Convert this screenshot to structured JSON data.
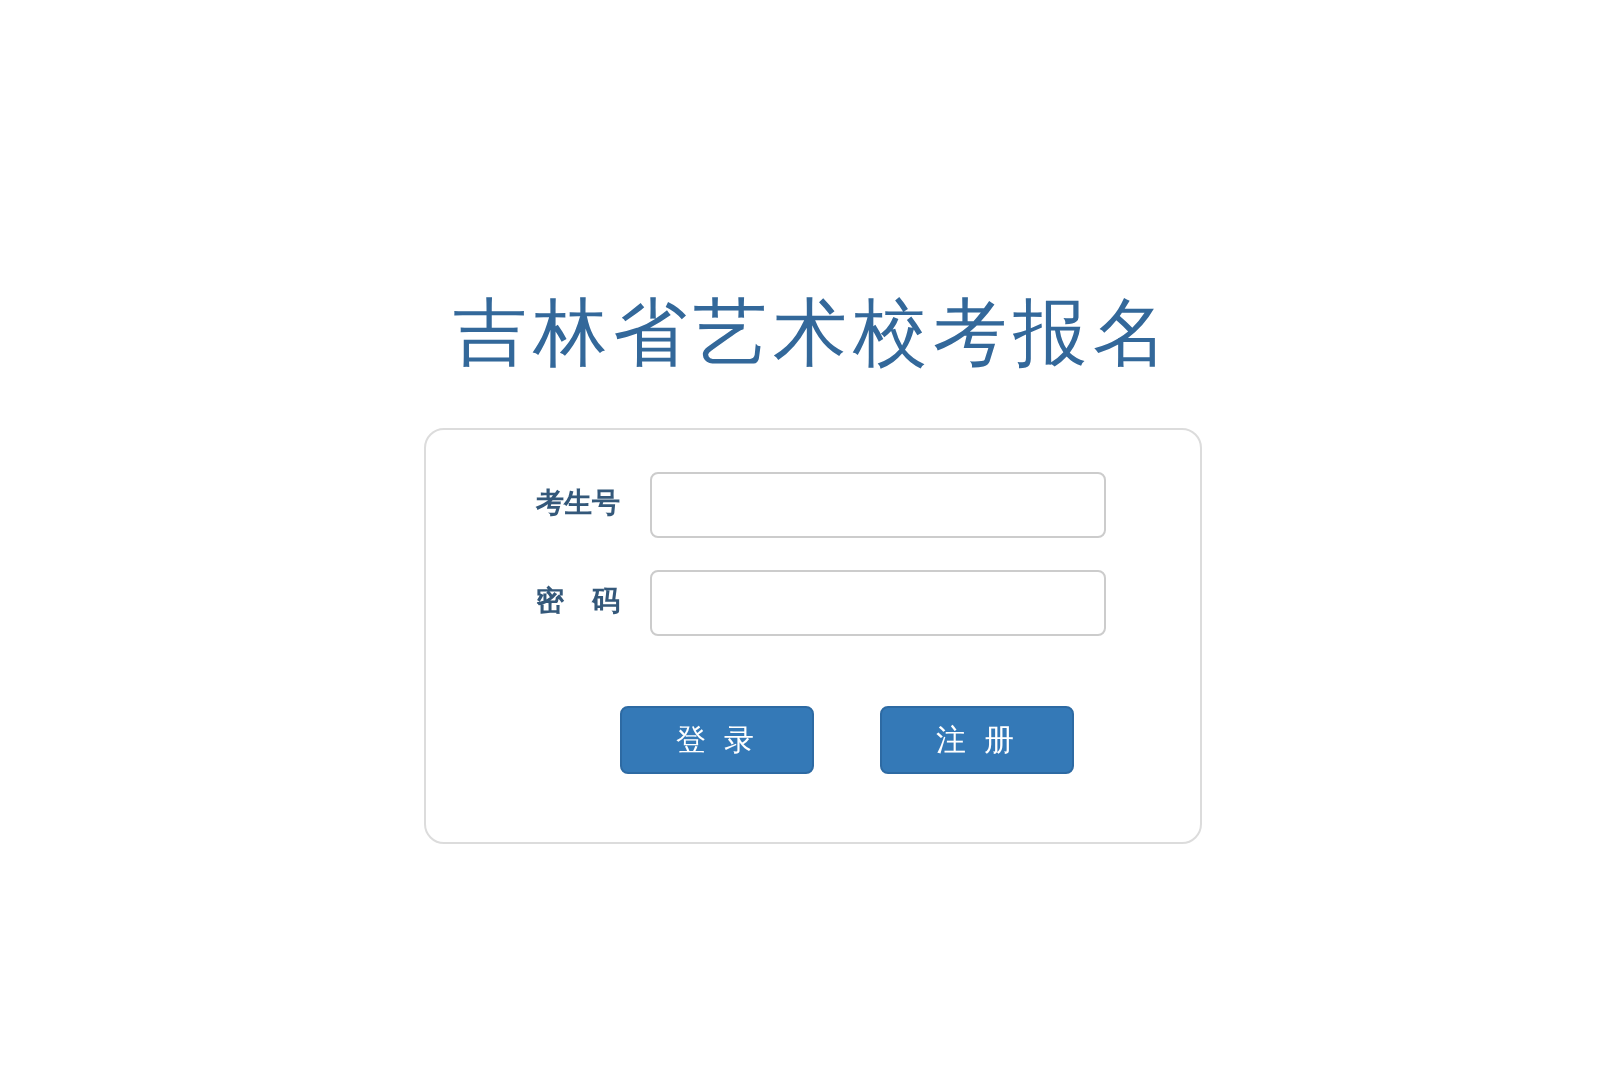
{
  "title": "吉林省艺术校考报名",
  "fields": [
    {
      "label": "考生号"
    },
    {
      "label": "密　码"
    }
  ],
  "buttons": [
    "登 录",
    "注 册"
  ]
}
